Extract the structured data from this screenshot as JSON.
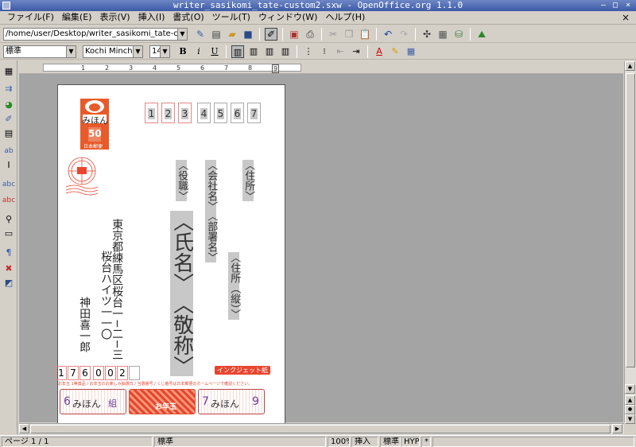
{
  "window": {
    "title": "writer_sasikomi_tate-custom2.sxw - OpenOffice.org 1.1.0",
    "minimize_glyph": "–",
    "maximize_glyph": "□",
    "close_glyph": "×"
  },
  "menubar": {
    "items": [
      "ファイル(F)",
      "編集(E)",
      "表示(V)",
      "挿入(I)",
      "書式(O)",
      "ツール(T)",
      "ウィンドウ(W)",
      "ヘルプ(H)"
    ],
    "close_doc": "×"
  },
  "toolbar": {
    "url_value": "/home/user/Desktop/writer_sasikomi_tate-custom2.sxw",
    "paragraph_style": "標準",
    "font_name": "Kochi Mincho",
    "font_size": "14",
    "bold": "B",
    "italic": "i",
    "underline": "U"
  },
  "ruler": {
    "marks": [
      "1",
      "2",
      "3",
      "4",
      "5",
      "6",
      "7",
      "8",
      "9"
    ]
  },
  "postcard": {
    "stamp_brand": "みほん",
    "stamp_value": "50",
    "stamp_caption": "日本郵便",
    "postal_boxes": [
      "1",
      "2",
      "3",
      "4",
      "5",
      "6",
      "7"
    ],
    "fields": {
      "address": "〈住所〉",
      "company": "〈会社名〉",
      "title": "〈役職〉",
      "department": "〈部署名〉",
      "name": "〈氏名〉",
      "honorific": "〈敬称〉",
      "address_vertical": "〈住所（縦）〉"
    },
    "sender": {
      "address_line1": "東京都練馬区桜台一−二−三",
      "address_line2": "桜台ハイツ一一〇",
      "name": "神田喜一郎"
    },
    "sender_zip": [
      "1",
      "7",
      "6",
      "0",
      "0",
      "2",
      ""
    ],
    "inkjet_label": "インクジェット紙",
    "lottery_notice": "お年玉 1等賞品 / お年玉のお楽しみ抽選日 / 当選番号 / くじ番号は日本郵便のホームページで確認ください。",
    "lottery": {
      "left_number": "6",
      "left_text": "みほん",
      "left_suffix": "組",
      "center_text": "お年玉",
      "right_number_left": "7",
      "right_text": "みほん",
      "right_number_right": "9"
    }
  },
  "statusbar": {
    "page": "ページ 1 / 1",
    "style": "標準",
    "zoom": "100%",
    "insert_mode": "挿入",
    "selection_mode": "標準",
    "hyperlink_mode": "HYP",
    "modified": "*"
  },
  "colors": {
    "accent_red": "#e8452f",
    "stamp_orange": "#e85a2a",
    "field_gray": "#c8c8c8"
  }
}
